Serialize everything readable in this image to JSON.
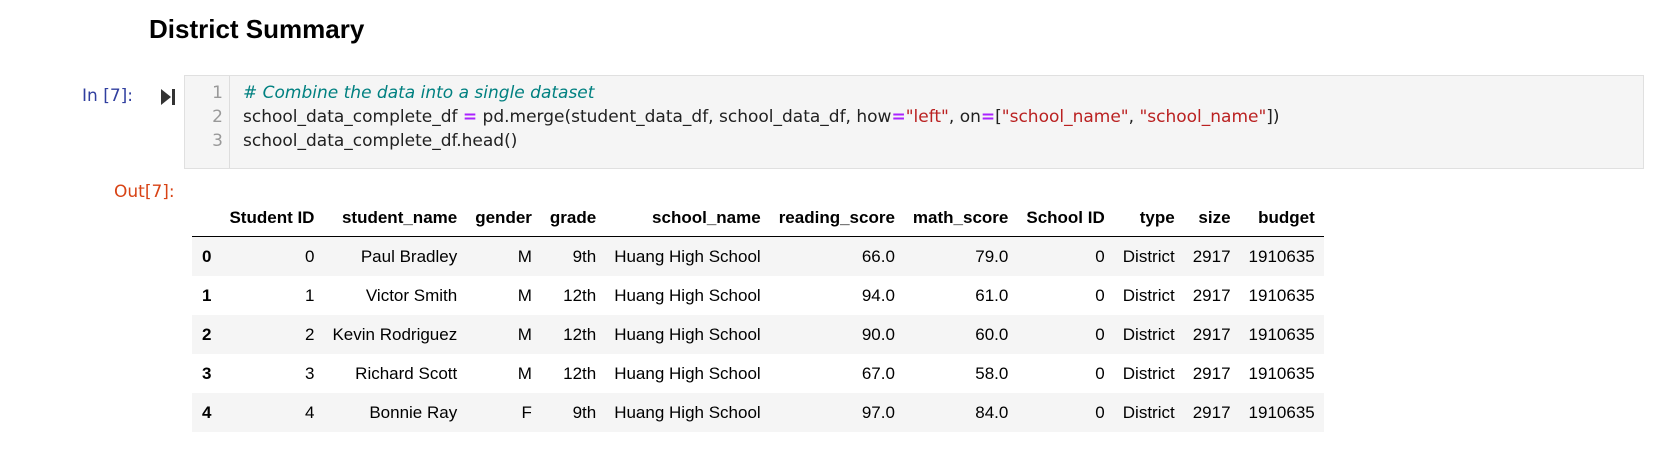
{
  "heading": "District Summary",
  "input_prompt": "In [7]:",
  "output_prompt": "Out[7]:",
  "code": {
    "line_numbers": [
      "1",
      "2",
      "3"
    ],
    "line1_comment": "# Combine the data into a single dataset",
    "line2": {
      "var": "school_data_complete_df ",
      "eq": "=",
      "call": " pd.merge(student_data_df, school_data_df, how",
      "eq2": "=",
      "how_val": "\"left\"",
      "on_part": ", on",
      "eq3": "=",
      "open": "[",
      "key1": "\"school_name\"",
      "sep": ", ",
      "key2": "\"school_name\"",
      "close": "])"
    },
    "line3": "school_data_complete_df.head()"
  },
  "table": {
    "columns": [
      "Student ID",
      "student_name",
      "gender",
      "grade",
      "school_name",
      "reading_score",
      "math_score",
      "School ID",
      "type",
      "size",
      "budget"
    ],
    "rows": [
      {
        "index": "0",
        "cells": [
          "0",
          "Paul Bradley",
          "M",
          "9th",
          "Huang High School",
          "66.0",
          "79.0",
          "0",
          "District",
          "2917",
          "1910635"
        ]
      },
      {
        "index": "1",
        "cells": [
          "1",
          "Victor Smith",
          "M",
          "12th",
          "Huang High School",
          "94.0",
          "61.0",
          "0",
          "District",
          "2917",
          "1910635"
        ]
      },
      {
        "index": "2",
        "cells": [
          "2",
          "Kevin Rodriguez",
          "M",
          "12th",
          "Huang High School",
          "90.0",
          "60.0",
          "0",
          "District",
          "2917",
          "1910635"
        ]
      },
      {
        "index": "3",
        "cells": [
          "3",
          "Richard Scott",
          "M",
          "12th",
          "Huang High School",
          "67.0",
          "58.0",
          "0",
          "District",
          "2917",
          "1910635"
        ]
      },
      {
        "index": "4",
        "cells": [
          "4",
          "Bonnie Ray",
          "F",
          "9th",
          "Huang High School",
          "97.0",
          "84.0",
          "0",
          "District",
          "2917",
          "1910635"
        ]
      }
    ]
  },
  "icons": {
    "run": "run-cell-icon"
  },
  "colors": {
    "comment": "#008080",
    "string": "#ba2121",
    "operator": "#aa22ff",
    "in_prompt": "#303f9f",
    "out_prompt": "#d84315"
  }
}
